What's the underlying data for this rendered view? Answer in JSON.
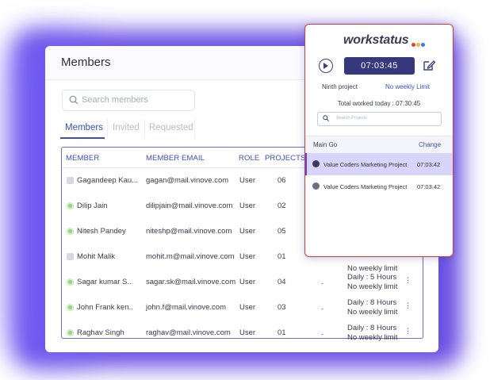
{
  "members_panel": {
    "title": "Members",
    "search_placeholder": "Search members",
    "tabs": [
      {
        "label": "Members",
        "active": true
      },
      {
        "label": "Invited",
        "active": false
      },
      {
        "label": "Requested",
        "active": false
      }
    ],
    "columns": [
      "MEMBER",
      "MEMBER EMAIL",
      "ROLE",
      "PROJECTS"
    ],
    "rows": [
      {
        "name": "Gagandeep Kau...",
        "email": "gagan@mail.vinove.com",
        "role": "User",
        "projects": "06",
        "online": false
      },
      {
        "name": "Dilip Jain",
        "email": "dilipjain@mail.vinove.com",
        "role": "User",
        "projects": "02",
        "online": true
      },
      {
        "name": "Nitesh Pandey",
        "email": "niteshp@mail.vinove.com",
        "role": "User",
        "projects": "05",
        "online": true
      },
      {
        "name": "Mohit Malik",
        "email": "mohit.m@mail.vinove.com",
        "role": "User",
        "projects": "01",
        "online": false,
        "limit_partial": "No weekly limit"
      },
      {
        "name": "Sagar kumar S..",
        "email": "sagar.sk@mail.vinove.com",
        "role": "User",
        "projects": "04",
        "online": true,
        "dash": "-",
        "daily": "Daily : 5 Hours",
        "weekly": "No weekly limit"
      },
      {
        "name": "John Frank ken..",
        "email": "john.f@mail.vinove.com",
        "role": "User",
        "projects": "03",
        "online": true,
        "dash": "-",
        "daily": "Daily : 8 Hours",
        "weekly": "No weekly limit"
      },
      {
        "name": "Raghav Singh",
        "email": "raghav@mail.vinove.com",
        "role": "User",
        "projects": "01",
        "online": true,
        "dash": "-",
        "daily": "Daily : 8 Hours",
        "weekly": "No weekly limit"
      }
    ]
  },
  "widget": {
    "logo_text": "workstatus",
    "logo_dot_colors": [
      "#e0413a",
      "#f2b632",
      "#3c7be0"
    ],
    "timer": "07:03:45",
    "project_label": "Ninth project",
    "limit_label": "No weekly Limit",
    "total_worked": "Total worked today : 07:30:45",
    "search_placeholder": "Search Projects",
    "section_title": "Main Go",
    "change_label": "Change",
    "projects": [
      {
        "name": "Value Coders Marketing Project",
        "time": "07:03:42",
        "active": true
      },
      {
        "name": "Value Coders Marketing Project",
        "time": "07:03:42",
        "active": false
      }
    ]
  }
}
